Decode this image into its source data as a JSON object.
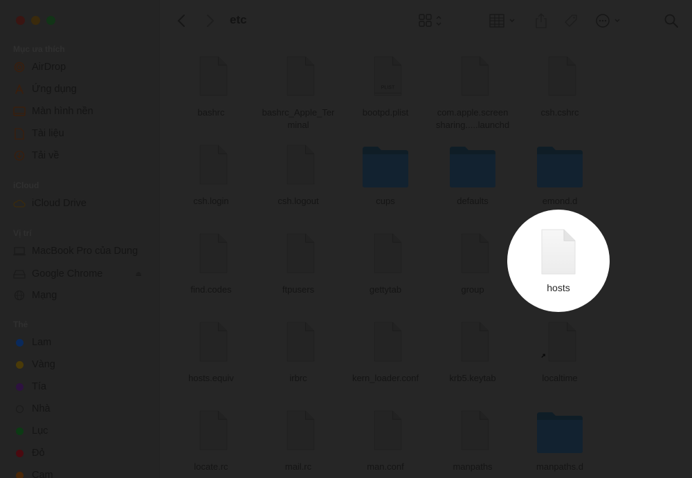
{
  "window": {
    "title": "etc",
    "traffic_lights": [
      "close",
      "minimize",
      "maximize"
    ]
  },
  "sidebar": {
    "sections": [
      {
        "title": "Mục ưa thích",
        "items": [
          {
            "label": "AirDrop",
            "icon": "airdrop-icon"
          },
          {
            "label": "Ứng dụng",
            "icon": "applications-icon"
          },
          {
            "label": "Màn hình nền",
            "icon": "desktop-icon"
          },
          {
            "label": "Tài liệu",
            "icon": "document-icon"
          },
          {
            "label": "Tải về",
            "icon": "download-icon"
          }
        ]
      },
      {
        "title": "iCloud",
        "items": [
          {
            "label": "iCloud Drive",
            "icon": "cloud-icon"
          }
        ]
      },
      {
        "title": "Vị trí",
        "items": [
          {
            "label": "MacBook Pro của Dung",
            "icon": "laptop-icon"
          },
          {
            "label": "Google Chrome",
            "icon": "disk-icon",
            "eject": "⏏"
          },
          {
            "label": "Mạng",
            "icon": "network-icon"
          }
        ]
      },
      {
        "title": "Thẻ",
        "items": [
          {
            "label": "Lam",
            "color": "#0a2a5c"
          },
          {
            "label": "Vàng",
            "color": "#4a3a08"
          },
          {
            "label": "Tía",
            "color": "#2e1240"
          },
          {
            "label": "Nhà",
            "color": "transparent"
          },
          {
            "label": "Lục",
            "color": "#0c3a14"
          },
          {
            "label": "Đỏ",
            "color": "#4a0a10"
          },
          {
            "label": "Cam",
            "color": "#4a2808"
          }
        ]
      }
    ]
  },
  "toolbar": {
    "back": "back-icon",
    "forward": "forward-icon",
    "title": "etc",
    "view_mode": "icon-view-icon",
    "group_by": "group-icon",
    "share": "share-icon",
    "tag": "tag-icon",
    "more": "more-icon",
    "search": "search-icon"
  },
  "files": [
    {
      "name": "bashrc",
      "type": "file"
    },
    {
      "name": "bashrc_Apple_Terminal",
      "type": "file"
    },
    {
      "name": "bootpd.plist",
      "type": "plist",
      "badge": "PLIST"
    },
    {
      "name": "com.apple.screensharing.....launchd",
      "type": "file"
    },
    {
      "name": "csh.cshrc",
      "type": "file"
    },
    {
      "name": "csh.login",
      "type": "file"
    },
    {
      "name": "csh.logout",
      "type": "file"
    },
    {
      "name": "cups",
      "type": "folder"
    },
    {
      "name": "defaults",
      "type": "folder"
    },
    {
      "name": "emond.d",
      "type": "folder"
    },
    {
      "name": "find.codes",
      "type": "file"
    },
    {
      "name": "ftpusers",
      "type": "file"
    },
    {
      "name": "gettytab",
      "type": "file"
    },
    {
      "name": "group",
      "type": "file"
    },
    {
      "name": "hosts",
      "type": "file",
      "highlighted": true
    },
    {
      "name": "hosts.equiv",
      "type": "file"
    },
    {
      "name": "irbrc",
      "type": "file"
    },
    {
      "name": "kern_loader.conf",
      "type": "file"
    },
    {
      "name": "krb5.keytab",
      "type": "file"
    },
    {
      "name": "localtime",
      "type": "alias"
    },
    {
      "name": "locate.rc",
      "type": "file"
    },
    {
      "name": "mail.rc",
      "type": "file"
    },
    {
      "name": "man.conf",
      "type": "file"
    },
    {
      "name": "manpaths",
      "type": "file"
    },
    {
      "name": "manpaths.d",
      "type": "folder"
    }
  ],
  "labels": {
    "file_label_lines": {
      "bashrc_Apple_Terminal": [
        "bashrc_Apple_Ter",
        "minal"
      ],
      "com.apple.screensharing.....launchd": [
        "com.apple.screen",
        "sharing.....launchd"
      ]
    }
  }
}
